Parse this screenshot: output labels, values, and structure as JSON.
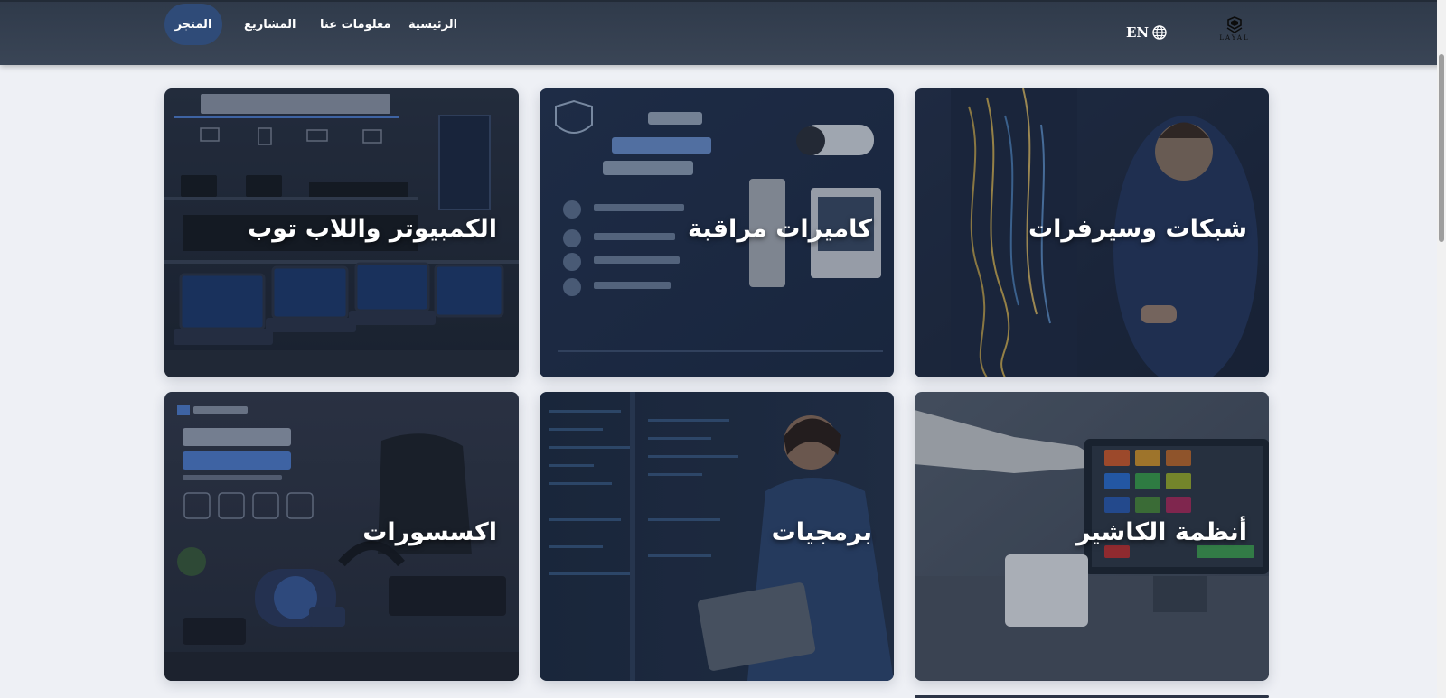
{
  "header": {
    "logo": {
      "text": "LAYAL",
      "icon": "layal-logo-icon"
    },
    "language": {
      "label": "EN",
      "icon": "globe-icon"
    },
    "nav": {
      "home": "الرئيسية",
      "about": "معلومات عنا",
      "projects": "المشاريع",
      "store": "المتجر"
    },
    "active_nav": "store"
  },
  "cards": [
    {
      "title": "شبكات وسيرفرات"
    },
    {
      "title": "كاميرات مراقبة"
    },
    {
      "title": "الكمبيوتر واللاب توب"
    },
    {
      "title": "أنظمة الكاشير"
    },
    {
      "title": "برمجيات"
    },
    {
      "title": "اكسسورات"
    }
  ],
  "colors": {
    "header_bg": "#333e4f",
    "active_nav_bg": "#2f4b78",
    "page_bg": "#eef0f5"
  }
}
